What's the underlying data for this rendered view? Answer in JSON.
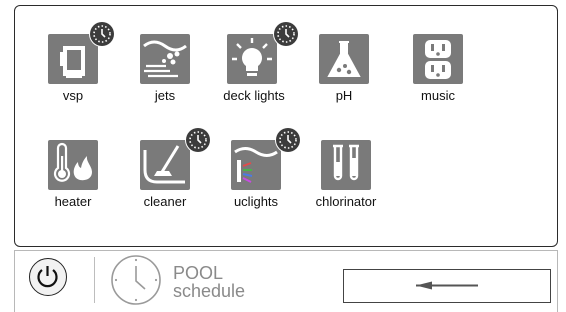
{
  "devices": [
    {
      "id": "vsp",
      "label": "vsp",
      "icon": "pump-icon",
      "scheduled": true
    },
    {
      "id": "jets",
      "label": "jets",
      "icon": "jets-icon",
      "scheduled": false
    },
    {
      "id": "deck-lights",
      "label": "deck lights",
      "icon": "light-bulb-icon",
      "scheduled": true
    },
    {
      "id": "ph",
      "label": "pH",
      "icon": "flask-icon",
      "scheduled": false
    },
    {
      "id": "music",
      "label": "music",
      "icon": "outlet-icon",
      "scheduled": false
    },
    {
      "id": "heater",
      "label": "heater",
      "icon": "thermometer-flame-icon",
      "scheduled": false
    },
    {
      "id": "cleaner",
      "label": "cleaner",
      "icon": "pool-cleaner-icon",
      "scheduled": true
    },
    {
      "id": "uclights",
      "label": "uclights",
      "icon": "underwater-light-icon",
      "scheduled": true
    },
    {
      "id": "chlorinator",
      "label": "chlorinator",
      "icon": "test-tubes-icon",
      "scheduled": false
    }
  ],
  "footer": {
    "schedule_line1": "POOL",
    "schedule_line2": "schedule",
    "power_icon": "power-icon",
    "back_icon": "arrow-left-icon"
  },
  "colors": {
    "icon_bg": "#7a7a7a",
    "clock_badge": "#3c3c3c",
    "border": "#2b2b2b"
  }
}
